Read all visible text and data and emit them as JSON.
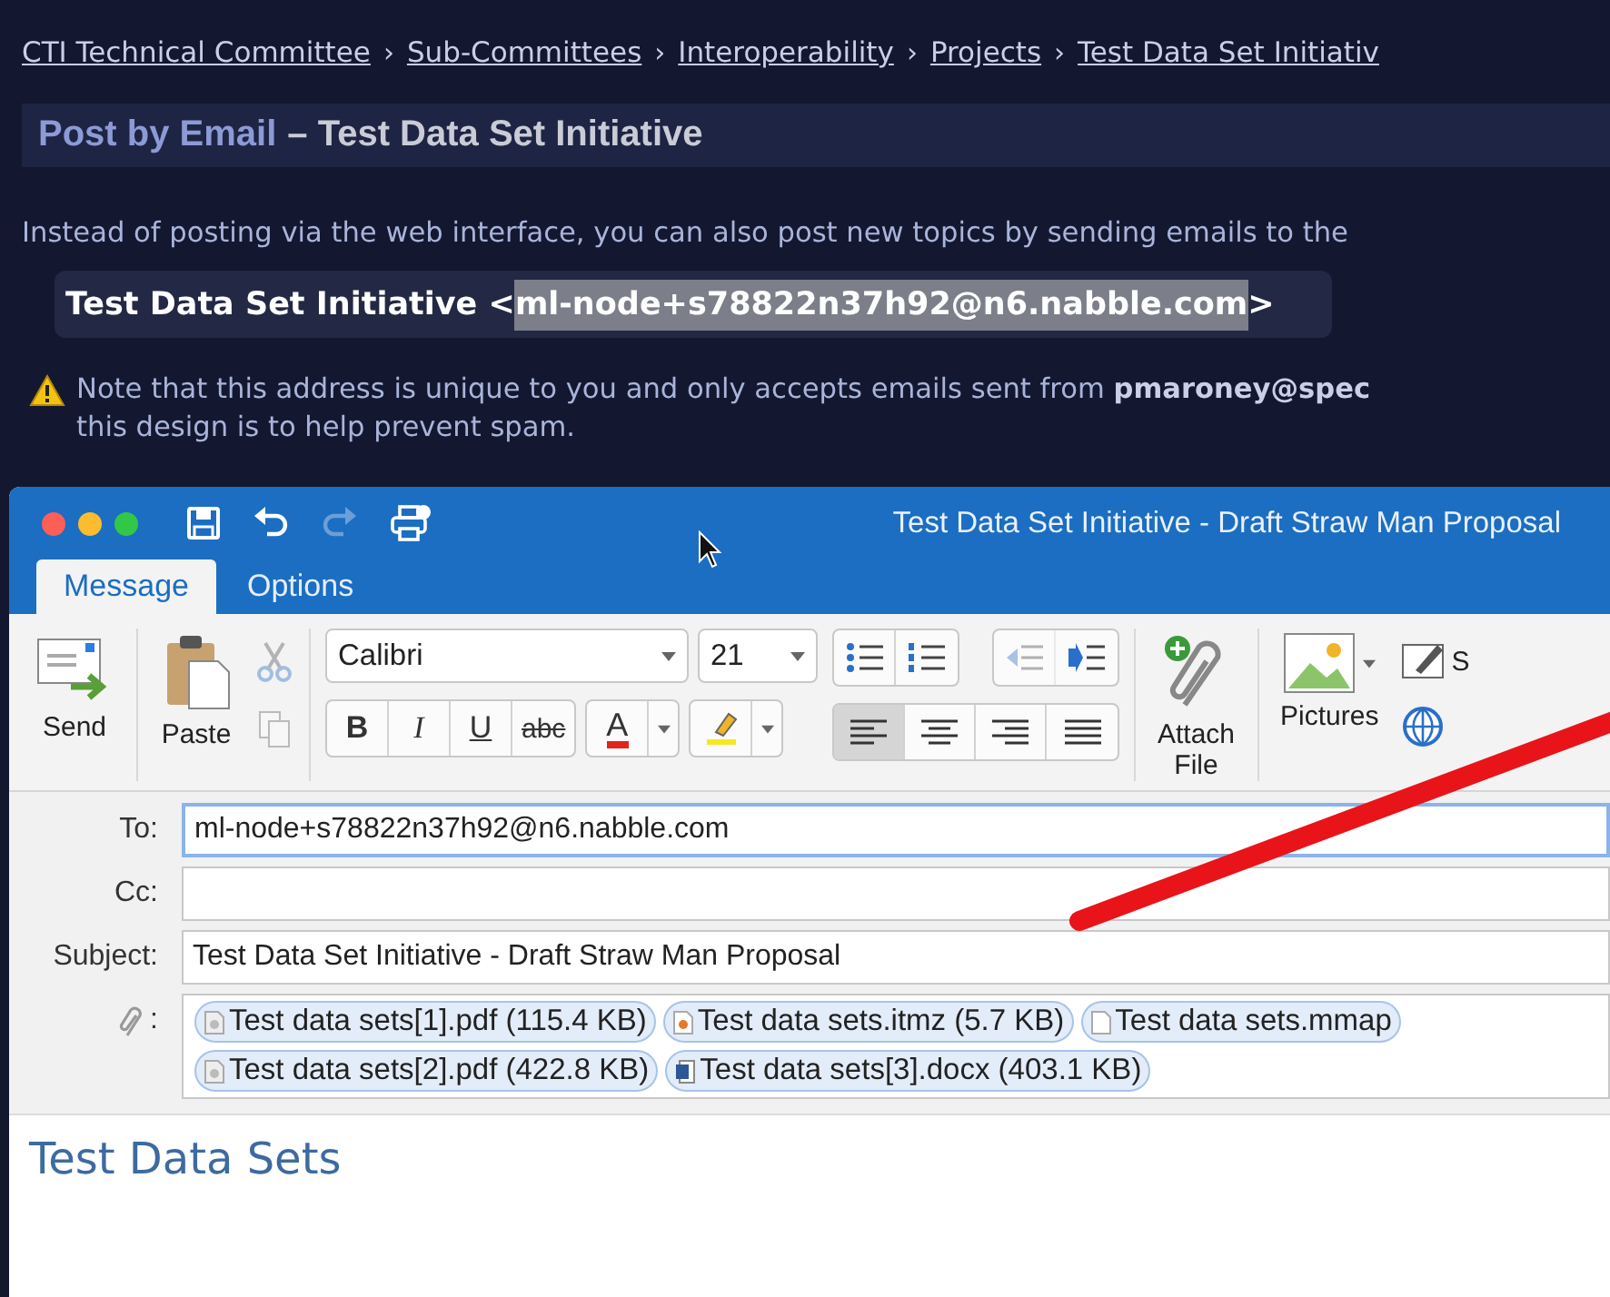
{
  "breadcrumb": [
    {
      "label": "CTI Technical Committee"
    },
    {
      "label": "Sub-Committees"
    },
    {
      "label": "Interoperability"
    },
    {
      "label": "Projects"
    },
    {
      "label": "Test Data Set Initiativ"
    }
  ],
  "separator": "›",
  "header": {
    "link": "Post by Email",
    "title": "– Test Data Set Initiative"
  },
  "intro": "Instead of posting via the web interface, you can also post new topics by sending emails to the",
  "address": {
    "prefix": "Test Data Set Initiative <",
    "email": "ml-node+s78822n37h92@n6.nabble.com",
    "suffix": ">",
    "highlighted": true
  },
  "note_lines": [
    "Note that this address is unique to you and only accepts emails sent from **pmaroney@spec**",
    "this design is to help prevent spam."
  ],
  "compose": {
    "title": "Test Data Set Initiative - Draft Straw Man Proposal",
    "tabs": [
      {
        "label": "Message",
        "selected": true
      },
      {
        "label": "Options",
        "selected": false
      }
    ],
    "ribbon": {
      "send": "Send",
      "paste": "Paste",
      "cut_disabled": true,
      "copy_disabled": true,
      "font": "Calibri",
      "size": "21",
      "format_buttons": [
        {
          "label": "B",
          "kind": "bold"
        },
        {
          "label": "I",
          "kind": "italic"
        },
        {
          "label": "U",
          "kind": "underline"
        },
        {
          "label": "abc",
          "kind": "strike"
        }
      ],
      "font_color": "A",
      "outdent_disabled": true,
      "align_buttons": [
        {
          "kind": "left",
          "selected": true
        },
        {
          "kind": "center",
          "selected": false
        },
        {
          "kind": "right",
          "selected": false
        },
        {
          "kind": "justify",
          "selected": false
        }
      ],
      "attach_lines": [
        "Attach",
        "File"
      ],
      "pictures": "Pictures",
      "cut_label": "S"
    },
    "fields": [
      {
        "label": "To:",
        "value": "ml-node+s78822n37h92@n6.nabble.com",
        "focused": true
      },
      {
        "label": "Cc:",
        "focused": false
      },
      {
        "label": "Subject:",
        "value": "Test Data Set Initiative - Draft Straw Man Proposal",
        "focused": false
      }
    ],
    "attachment_label": ":",
    "attachments": [
      [
        {
          "name": "Test data sets[1].pdf (115.4 KB)",
          "kind": "pdf"
        },
        {
          "name": "Test data sets.itmz (5.7 KB)",
          "kind": "itmz"
        },
        {
          "name": "Test data sets.mmap",
          "kind": "file"
        }
      ],
      [
        {
          "name": "Test data sets[2].pdf (422.8 KB)",
          "kind": "pdf"
        },
        {
          "name": "Test data sets[3].docx (403.1 KB)",
          "kind": "docx"
        }
      ]
    ],
    "body_heading": "Test Data Sets"
  }
}
